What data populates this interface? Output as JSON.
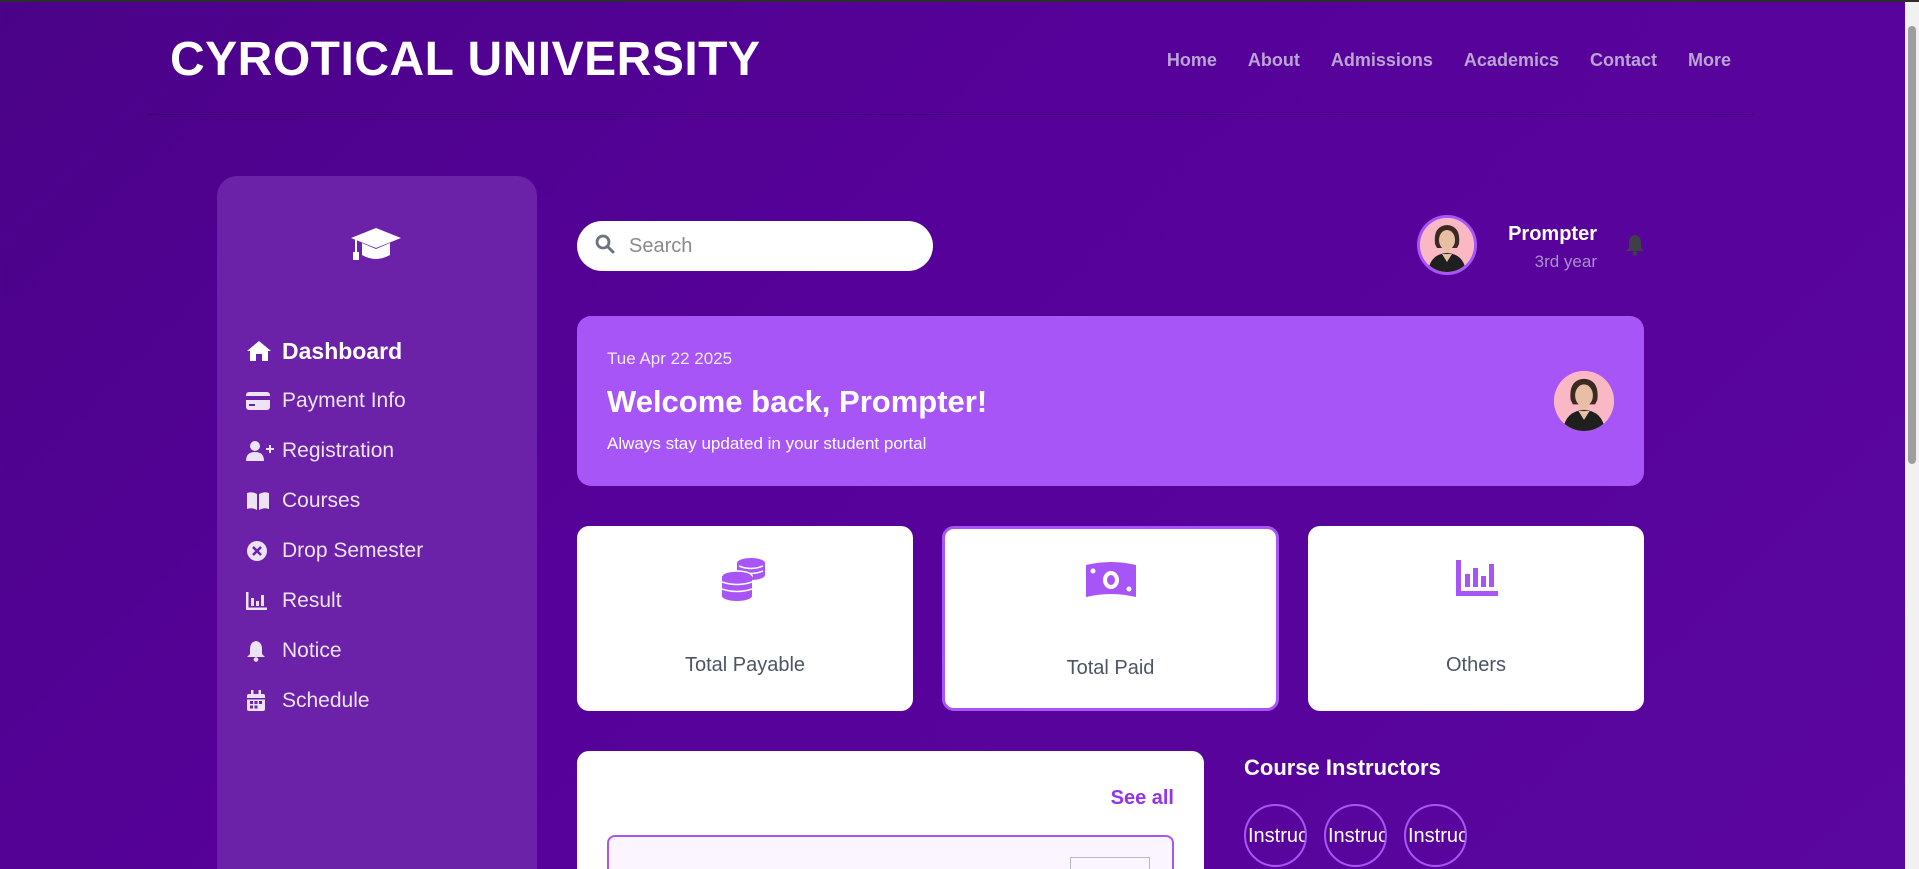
{
  "site": {
    "brand": "CYROTICAL UNIVERSITY",
    "nav": [
      "Home",
      "About",
      "Admissions",
      "Academics",
      "Contact",
      "More"
    ]
  },
  "sidebar": {
    "logo_icon": "graduation-cap-icon",
    "items": [
      {
        "label": "Dashboard",
        "icon": "home-icon",
        "active": true
      },
      {
        "label": "Payment Info",
        "icon": "credit-card-icon"
      },
      {
        "label": "Registration",
        "icon": "user-plus-icon"
      },
      {
        "label": "Courses",
        "icon": "book-open-icon"
      },
      {
        "label": "Drop Semester",
        "icon": "circle-x-icon"
      },
      {
        "label": "Result",
        "icon": "bar-chart-icon"
      },
      {
        "label": "Notice",
        "icon": "bell-icon"
      },
      {
        "label": "Schedule",
        "icon": "calendar-icon"
      }
    ]
  },
  "search": {
    "placeholder": "Search"
  },
  "profile": {
    "name": "Prompter",
    "year": "3rd year"
  },
  "banner": {
    "date": "Tue Apr 22 2025",
    "title": "Welcome back, Prompter!",
    "subtitle": "Always stay updated in your student portal"
  },
  "cards": [
    {
      "label": "Total Payable",
      "icon": "coins-icon"
    },
    {
      "label": "Total Paid",
      "icon": "money-bill-icon",
      "selected": true
    },
    {
      "label": "Others",
      "icon": "chart-bars-icon"
    }
  ],
  "panel": {
    "see_all": "See all"
  },
  "instructors": {
    "title": "Course Instructors",
    "items": [
      {
        "alt": "Instructor"
      },
      {
        "alt": "Instructor"
      },
      {
        "alt": "Instructor"
      }
    ]
  },
  "colors": {
    "accent": "#a855f7",
    "sidebar": "#6b21a8",
    "background": "#560199"
  }
}
